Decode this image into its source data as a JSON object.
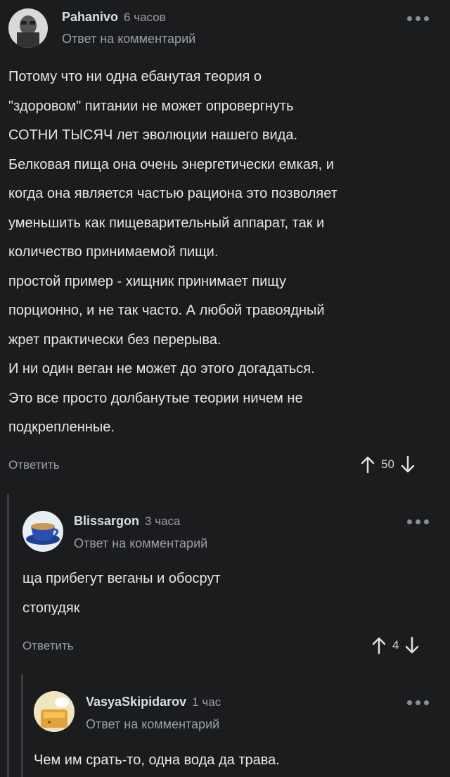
{
  "comments": [
    {
      "author": "Pahanivo",
      "time": "6 часов",
      "reply_label": "Ответ на комментарий",
      "paragraphs": [
        "Потому что ни одна ебанутая теория о",
        "\"здоровом\" питании не может опровергнуть",
        "СОТНИ ТЫСЯЧ лет эволюции нашего вида.",
        "Белковая пища она очень энергетически емкая, и",
        "когда она является частью рациона это позволяет",
        "уменьшить как пищеварительный аппарат, так и",
        "количество принимаемой пищи.",
        "простой пример - хищник принимает пищу",
        "порционно, и не так часто. А любой травоядный",
        "жрет практически без перерыва.",
        "И ни один веган не может до этого догадаться.",
        "Это все просто долбанутые теории ничем не",
        "подкрепленные."
      ],
      "reply_button": "Ответить",
      "score": "50"
    },
    {
      "author": "Blissargon",
      "time": "3 часа",
      "reply_label": "Ответ на комментарий",
      "paragraphs": [
        "ща прибегут веганы и обосрут",
        "стопудяк"
      ],
      "reply_button": "Ответить",
      "score": "4"
    },
    {
      "author": "VasyaSkipidarov",
      "time": "1 час",
      "reply_label": "Ответ на комментарий",
      "paragraphs": [
        "Чем им срать-то, одна вода да трава."
      ]
    }
  ],
  "icons": {
    "more": "more-dots-icon",
    "upvote": "arrow-up-icon",
    "downvote": "arrow-down-icon"
  },
  "colors": {
    "background": "#1b1c1e",
    "thread_line": "#3a3b3e",
    "muted": "#9a9ea5"
  }
}
